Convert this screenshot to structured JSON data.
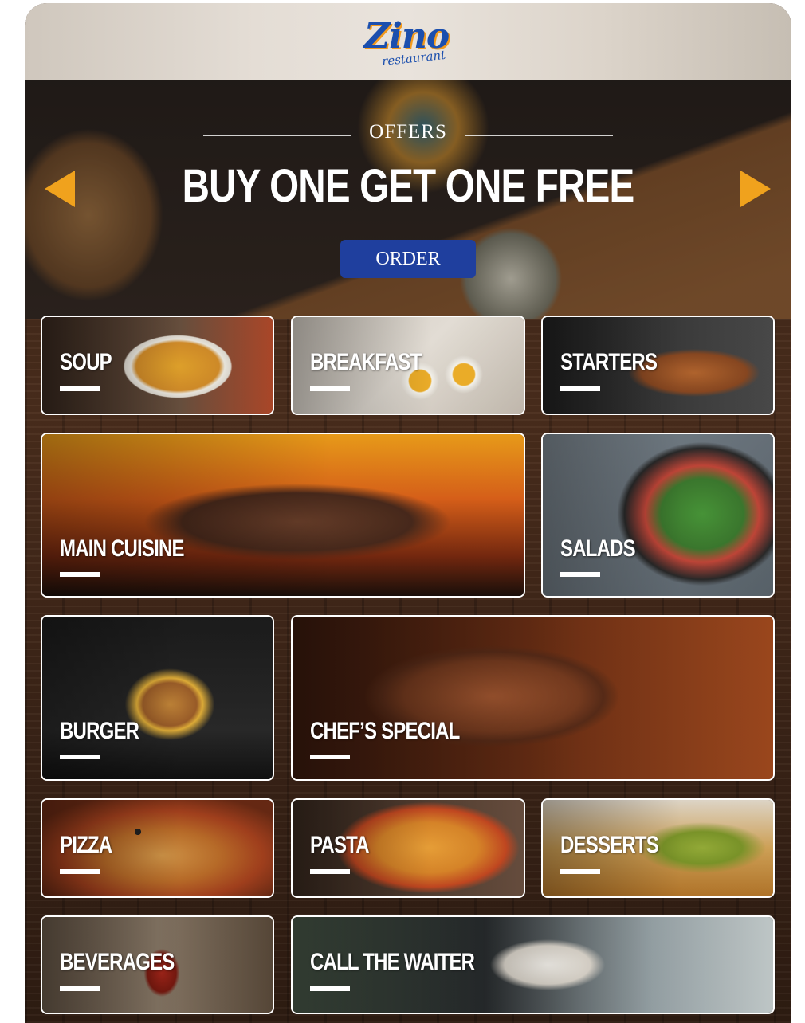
{
  "header": {
    "logo_word": "Zino",
    "logo_sub": "restaurant"
  },
  "hero": {
    "kicker": "OFFERS",
    "title": "BUY ONE GET ONE FREE",
    "order_label": "ORDER"
  },
  "menu": {
    "soup": "SOUP",
    "breakfast": "BREAKFAST",
    "starters": "STARTERS",
    "main_cuisine": "MAIN CUISINE",
    "salads": "SALADS",
    "burger": "BURGER",
    "chefs_special": "CHEF’S SPECIAL",
    "pizza": "PIZZA",
    "pasta": "PASTA",
    "desserts": "DESSERTS",
    "beverages": "BEVERAGES",
    "call_waiter": "CALL THE WAITER"
  },
  "colors": {
    "accent_orange": "#f0a21d",
    "order_blue": "#1f3f9e",
    "logo_blue": "#1b4fae"
  }
}
